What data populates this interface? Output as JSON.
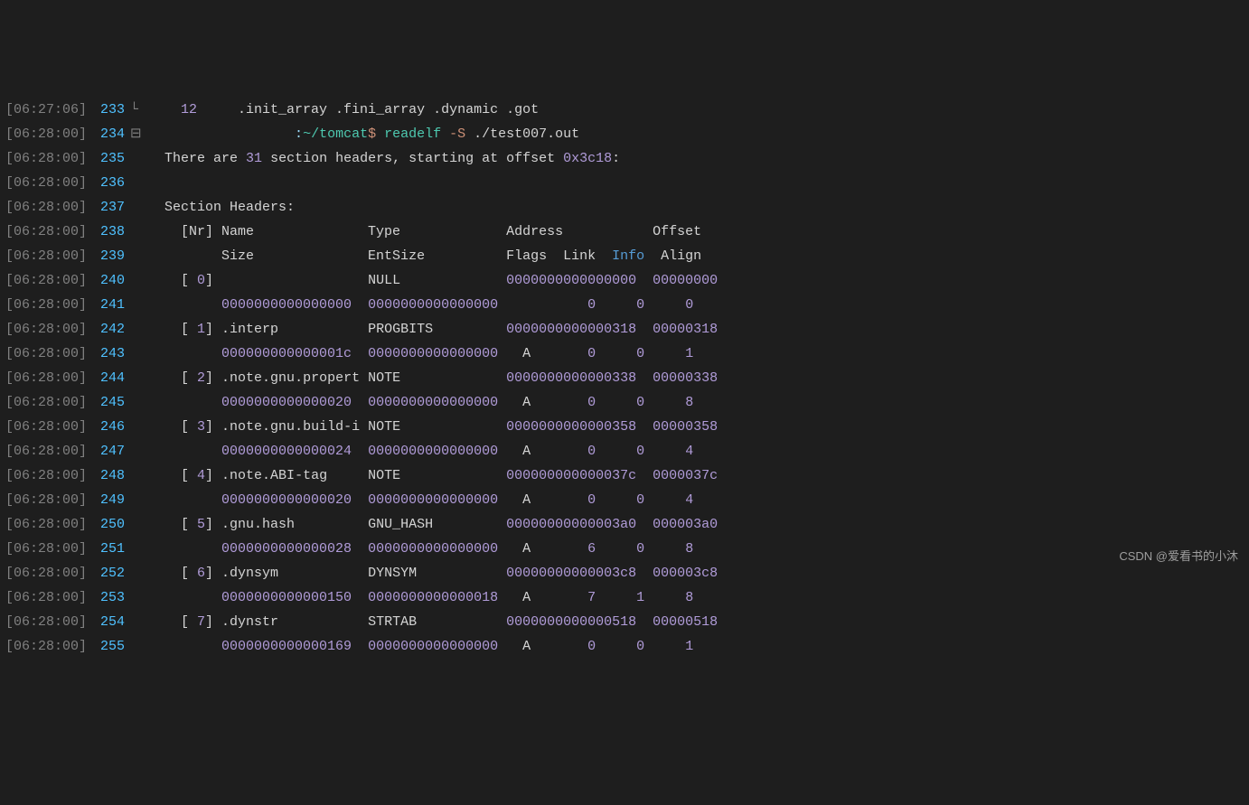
{
  "watermark": "CSDN @爱看书的小沐",
  "lines": [
    {
      "ts": "[06:27:06]",
      "ln": "233",
      "gutter": "└",
      "segs": [
        {
          "c": "num",
          "t": "    12"
        },
        {
          "c": "white",
          "t": "     .init_array .fini_array .dynamic .got"
        }
      ]
    },
    {
      "ts": "[06:28:00]",
      "ln": "234",
      "gutter": "⊟",
      "segs": [
        {
          "c": "white",
          "t": "                  "
        },
        {
          "c": "prompt-path",
          "t": ":"
        },
        {
          "c": "cyan",
          "t": "~/tomcat"
        },
        {
          "c": "prompt-d",
          "t": "$ "
        },
        {
          "c": "cyan",
          "t": "readelf "
        },
        {
          "c": "opt",
          "t": "-S"
        },
        {
          "c": "white",
          "t": " ./test007.out"
        }
      ]
    },
    {
      "ts": "[06:28:00]",
      "ln": "235",
      "gutter": " ",
      "segs": [
        {
          "c": "white",
          "t": "  There are "
        },
        {
          "c": "num",
          "t": "31"
        },
        {
          "c": "white",
          "t": " section headers, starting at offset "
        },
        {
          "c": "num",
          "t": "0x3c18"
        },
        {
          "c": "white",
          "t": ":"
        }
      ]
    },
    {
      "ts": "[06:28:00]",
      "ln": "236",
      "gutter": " ",
      "segs": []
    },
    {
      "ts": "[06:28:00]",
      "ln": "237",
      "gutter": " ",
      "segs": [
        {
          "c": "white",
          "t": "  Section Headers:"
        }
      ]
    },
    {
      "ts": "[06:28:00]",
      "ln": "238",
      "gutter": " ",
      "segs": [
        {
          "c": "white",
          "t": "    [Nr] Name              Type             Address           Offset"
        }
      ]
    },
    {
      "ts": "[06:28:00]",
      "ln": "239",
      "gutter": " ",
      "segs": [
        {
          "c": "white",
          "t": "         Size              EntSize          Flags  Link  "
        },
        {
          "c": "key",
          "t": "Info"
        },
        {
          "c": "white",
          "t": "  Align"
        }
      ]
    },
    {
      "ts": "[06:28:00]",
      "ln": "240",
      "gutter": " ",
      "segs": [
        {
          "c": "white",
          "t": "    [ "
        },
        {
          "c": "num",
          "t": "0"
        },
        {
          "c": "white",
          "t": "]                   NULL             "
        },
        {
          "c": "addr",
          "t": "0000000000000000"
        },
        {
          "c": "white",
          "t": "  "
        },
        {
          "c": "addr",
          "t": "00000000"
        }
      ]
    },
    {
      "ts": "[06:28:00]",
      "ln": "241",
      "gutter": " ",
      "segs": [
        {
          "c": "white",
          "t": "         "
        },
        {
          "c": "addr",
          "t": "0000000000000000"
        },
        {
          "c": "white",
          "t": "  "
        },
        {
          "c": "addr",
          "t": "0000000000000000"
        },
        {
          "c": "white",
          "t": "           "
        },
        {
          "c": "num",
          "t": "0"
        },
        {
          "c": "white",
          "t": "     "
        },
        {
          "c": "num",
          "t": "0"
        },
        {
          "c": "white",
          "t": "     "
        },
        {
          "c": "num",
          "t": "0"
        }
      ]
    },
    {
      "ts": "[06:28:00]",
      "ln": "242",
      "gutter": " ",
      "segs": [
        {
          "c": "white",
          "t": "    [ "
        },
        {
          "c": "num",
          "t": "1"
        },
        {
          "c": "white",
          "t": "] .interp           PROGBITS         "
        },
        {
          "c": "addr",
          "t": "0000000000000318"
        },
        {
          "c": "white",
          "t": "  "
        },
        {
          "c": "addr",
          "t": "00000318"
        }
      ]
    },
    {
      "ts": "[06:28:00]",
      "ln": "243",
      "gutter": " ",
      "segs": [
        {
          "c": "white",
          "t": "         "
        },
        {
          "c": "addr",
          "t": "000000000000001c"
        },
        {
          "c": "white",
          "t": "  "
        },
        {
          "c": "addr",
          "t": "0000000000000000"
        },
        {
          "c": "white",
          "t": "   A       "
        },
        {
          "c": "num",
          "t": "0"
        },
        {
          "c": "white",
          "t": "     "
        },
        {
          "c": "num",
          "t": "0"
        },
        {
          "c": "white",
          "t": "     "
        },
        {
          "c": "num",
          "t": "1"
        }
      ]
    },
    {
      "ts": "[06:28:00]",
      "ln": "244",
      "gutter": " ",
      "segs": [
        {
          "c": "white",
          "t": "    [ "
        },
        {
          "c": "num",
          "t": "2"
        },
        {
          "c": "white",
          "t": "] .note.gnu.propert NOTE             "
        },
        {
          "c": "addr",
          "t": "0000000000000338"
        },
        {
          "c": "white",
          "t": "  "
        },
        {
          "c": "addr",
          "t": "00000338"
        }
      ]
    },
    {
      "ts": "[06:28:00]",
      "ln": "245",
      "gutter": " ",
      "segs": [
        {
          "c": "white",
          "t": "         "
        },
        {
          "c": "addr",
          "t": "0000000000000020"
        },
        {
          "c": "white",
          "t": "  "
        },
        {
          "c": "addr",
          "t": "0000000000000000"
        },
        {
          "c": "white",
          "t": "   A       "
        },
        {
          "c": "num",
          "t": "0"
        },
        {
          "c": "white",
          "t": "     "
        },
        {
          "c": "num",
          "t": "0"
        },
        {
          "c": "white",
          "t": "     "
        },
        {
          "c": "num",
          "t": "8"
        }
      ]
    },
    {
      "ts": "[06:28:00]",
      "ln": "246",
      "gutter": " ",
      "segs": [
        {
          "c": "white",
          "t": "    [ "
        },
        {
          "c": "num",
          "t": "3"
        },
        {
          "c": "white",
          "t": "] .note.gnu.build-i NOTE             "
        },
        {
          "c": "addr",
          "t": "0000000000000358"
        },
        {
          "c": "white",
          "t": "  "
        },
        {
          "c": "addr",
          "t": "00000358"
        }
      ]
    },
    {
      "ts": "[06:28:00]",
      "ln": "247",
      "gutter": " ",
      "segs": [
        {
          "c": "white",
          "t": "         "
        },
        {
          "c": "addr",
          "t": "0000000000000024"
        },
        {
          "c": "white",
          "t": "  "
        },
        {
          "c": "addr",
          "t": "0000000000000000"
        },
        {
          "c": "white",
          "t": "   A       "
        },
        {
          "c": "num",
          "t": "0"
        },
        {
          "c": "white",
          "t": "     "
        },
        {
          "c": "num",
          "t": "0"
        },
        {
          "c": "white",
          "t": "     "
        },
        {
          "c": "num",
          "t": "4"
        }
      ]
    },
    {
      "ts": "[06:28:00]",
      "ln": "248",
      "gutter": " ",
      "segs": [
        {
          "c": "white",
          "t": "    [ "
        },
        {
          "c": "num",
          "t": "4"
        },
        {
          "c": "white",
          "t": "] .note.ABI-tag     NOTE             "
        },
        {
          "c": "addr",
          "t": "000000000000037c"
        },
        {
          "c": "white",
          "t": "  "
        },
        {
          "c": "addr",
          "t": "0000037c"
        }
      ]
    },
    {
      "ts": "[06:28:00]",
      "ln": "249",
      "gutter": " ",
      "segs": [
        {
          "c": "white",
          "t": "         "
        },
        {
          "c": "addr",
          "t": "0000000000000020"
        },
        {
          "c": "white",
          "t": "  "
        },
        {
          "c": "addr",
          "t": "0000000000000000"
        },
        {
          "c": "white",
          "t": "   A       "
        },
        {
          "c": "num",
          "t": "0"
        },
        {
          "c": "white",
          "t": "     "
        },
        {
          "c": "num",
          "t": "0"
        },
        {
          "c": "white",
          "t": "     "
        },
        {
          "c": "num",
          "t": "4"
        }
      ]
    },
    {
      "ts": "[06:28:00]",
      "ln": "250",
      "gutter": " ",
      "segs": [
        {
          "c": "white",
          "t": "    [ "
        },
        {
          "c": "num",
          "t": "5"
        },
        {
          "c": "white",
          "t": "] .gnu.hash         GNU_HASH         "
        },
        {
          "c": "addr",
          "t": "00000000000003a0"
        },
        {
          "c": "white",
          "t": "  "
        },
        {
          "c": "addr",
          "t": "000003a0"
        }
      ]
    },
    {
      "ts": "[06:28:00]",
      "ln": "251",
      "gutter": " ",
      "segs": [
        {
          "c": "white",
          "t": "         "
        },
        {
          "c": "addr",
          "t": "0000000000000028"
        },
        {
          "c": "white",
          "t": "  "
        },
        {
          "c": "addr",
          "t": "0000000000000000"
        },
        {
          "c": "white",
          "t": "   A       "
        },
        {
          "c": "num",
          "t": "6"
        },
        {
          "c": "white",
          "t": "     "
        },
        {
          "c": "num",
          "t": "0"
        },
        {
          "c": "white",
          "t": "     "
        },
        {
          "c": "num",
          "t": "8"
        }
      ]
    },
    {
      "ts": "[06:28:00]",
      "ln": "252",
      "gutter": " ",
      "segs": [
        {
          "c": "white",
          "t": "    [ "
        },
        {
          "c": "num",
          "t": "6"
        },
        {
          "c": "white",
          "t": "] .dynsym           DYNSYM           "
        },
        {
          "c": "addr",
          "t": "00000000000003c8"
        },
        {
          "c": "white",
          "t": "  "
        },
        {
          "c": "addr",
          "t": "000003c8"
        }
      ]
    },
    {
      "ts": "[06:28:00]",
      "ln": "253",
      "gutter": " ",
      "segs": [
        {
          "c": "white",
          "t": "         "
        },
        {
          "c": "addr",
          "t": "0000000000000150"
        },
        {
          "c": "white",
          "t": "  "
        },
        {
          "c": "addr",
          "t": "0000000000000018"
        },
        {
          "c": "white",
          "t": "   A       "
        },
        {
          "c": "num",
          "t": "7"
        },
        {
          "c": "white",
          "t": "     "
        },
        {
          "c": "num",
          "t": "1"
        },
        {
          "c": "white",
          "t": "     "
        },
        {
          "c": "num",
          "t": "8"
        }
      ]
    },
    {
      "ts": "[06:28:00]",
      "ln": "254",
      "gutter": " ",
      "segs": [
        {
          "c": "white",
          "t": "    [ "
        },
        {
          "c": "num",
          "t": "7"
        },
        {
          "c": "white",
          "t": "] .dynstr           STRTAB           "
        },
        {
          "c": "addr",
          "t": "0000000000000518"
        },
        {
          "c": "white",
          "t": "  "
        },
        {
          "c": "addr",
          "t": "00000518"
        }
      ]
    },
    {
      "ts": "[06:28:00]",
      "ln": "255",
      "gutter": " ",
      "segs": [
        {
          "c": "white",
          "t": "         "
        },
        {
          "c": "addr",
          "t": "0000000000000169"
        },
        {
          "c": "white",
          "t": "  "
        },
        {
          "c": "addr",
          "t": "0000000000000000"
        },
        {
          "c": "white",
          "t": "   A       "
        },
        {
          "c": "num",
          "t": "0"
        },
        {
          "c": "white",
          "t": "     "
        },
        {
          "c": "num",
          "t": "0"
        },
        {
          "c": "white",
          "t": "     "
        },
        {
          "c": "num",
          "t": "1"
        }
      ]
    }
  ]
}
